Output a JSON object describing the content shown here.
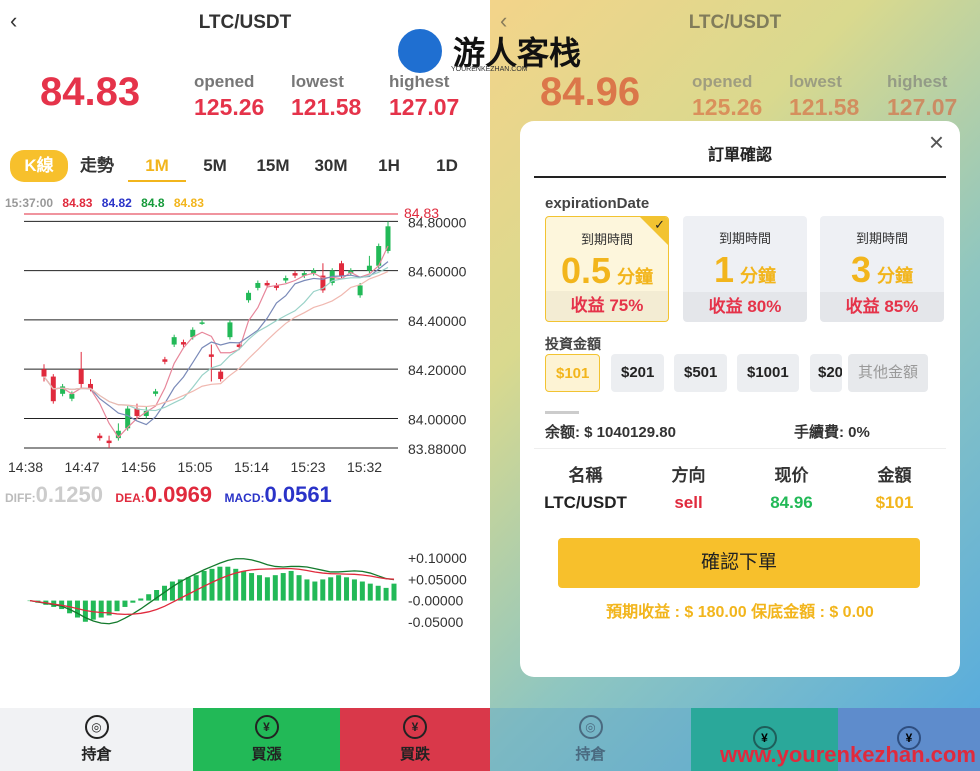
{
  "left": {
    "pair": "LTC/USDT",
    "price": "84.83",
    "stats": [
      {
        "label": "opened",
        "value": "125.26"
      },
      {
        "label": "lowest",
        "value": "121.58"
      },
      {
        "label": "highest",
        "value": "127.07"
      }
    ],
    "tabs": [
      "K線",
      "走勢",
      "1M",
      "5M",
      "15M",
      "30M",
      "1H",
      "1D"
    ],
    "legend": [
      "15:37:00",
      "84.83",
      "84.82",
      "84.8",
      "84.83"
    ],
    "macd": {
      "diff_label": "DIFF:",
      "diff": "0.1250",
      "dea_label": "DEA:",
      "dea": "0.0969",
      "macd_label": "MACD:",
      "macd": "0.0561"
    },
    "bottom": [
      "持倉",
      "買漲",
      "買跌"
    ]
  },
  "right": {
    "pair": "LTC/USDT",
    "price": "84.96",
    "stats": [
      {
        "label": "opened",
        "value": "125.26"
      },
      {
        "label": "lowest",
        "value": "121.58"
      },
      {
        "label": "highest",
        "value": "127.07"
      }
    ],
    "bottom": [
      "持倉"
    ]
  },
  "modal": {
    "title": "訂單確認",
    "close": "×",
    "expiration_label": "expirationDate",
    "options": [
      {
        "title": "到期時間",
        "num": "0.5",
        "unit": "分鐘",
        "profit": "收益 75%"
      },
      {
        "title": "到期時間",
        "num": "1",
        "unit": "分鐘",
        "profit": "收益 80%"
      },
      {
        "title": "到期時間",
        "num": "3",
        "unit": "分鐘",
        "profit": "收益 85%"
      }
    ],
    "amount_label": "投資金額",
    "amounts": [
      "$101",
      "$201",
      "$501",
      "$1001",
      "$20"
    ],
    "other_amount": "其他金額",
    "balance": "余额: $ 1040129.80",
    "fee": "手續費:  0%",
    "table_headers": [
      "名稱",
      "方向",
      "现价",
      "金額"
    ],
    "table_values": [
      "LTC/USDT",
      "sell",
      "84.96",
      "$101"
    ],
    "confirm": "確認下單",
    "footer": "預期收益 : $ 180.00    保底金額 : $ 0.00"
  },
  "watermark": {
    "text": "游人客栈",
    "sub": "YOURENKEZHAN.COM",
    "url": "www.yourenkezhan.com"
  },
  "chart_data": [
    {
      "type": "candlestick",
      "x_ticks": [
        "14:38",
        "14:47",
        "14:56",
        "15:05",
        "15:14",
        "15:23",
        "15:32"
      ],
      "y_ticks": [
        "84.80000",
        "84.60000",
        "84.40000",
        "84.20000",
        "84.00000",
        "83.88000"
      ],
      "last_price_label": "84.83",
      "ylim": [
        83.88,
        84.83
      ],
      "candles": [
        {
          "o": 84.2,
          "c": 84.17,
          "h": 84.22,
          "l": 84.15
        },
        {
          "o": 84.17,
          "c": 84.07,
          "h": 84.18,
          "l": 84.06
        },
        {
          "o": 84.1,
          "c": 84.13,
          "h": 84.14,
          "l": 84.09
        },
        {
          "o": 84.08,
          "c": 84.1,
          "h": 84.11,
          "l": 84.07
        },
        {
          "o": 84.2,
          "c": 84.14,
          "h": 84.27,
          "l": 84.12
        },
        {
          "o": 84.14,
          "c": 84.12,
          "h": 84.16,
          "l": 84.11
        },
        {
          "o": 83.93,
          "c": 83.92,
          "h": 83.94,
          "l": 83.91
        },
        {
          "o": 83.91,
          "c": 83.9,
          "h": 83.93,
          "l": 83.88
        },
        {
          "o": 83.92,
          "c": 83.95,
          "h": 83.98,
          "l": 83.91
        },
        {
          "o": 83.96,
          "c": 84.04,
          "h": 84.05,
          "l": 83.95
        },
        {
          "o": 84.04,
          "c": 84.01,
          "h": 84.06,
          "l": 84.0
        },
        {
          "o": 84.01,
          "c": 84.03,
          "h": 84.05,
          "l": 84.0
        },
        {
          "o": 84.1,
          "c": 84.11,
          "h": 84.12,
          "l": 84.09
        },
        {
          "o": 84.24,
          "c": 84.23,
          "h": 84.25,
          "l": 84.22
        },
        {
          "o": 84.3,
          "c": 84.33,
          "h": 84.34,
          "l": 84.29
        },
        {
          "o": 84.31,
          "c": 84.3,
          "h": 84.32,
          "l": 84.29
        },
        {
          "o": 84.33,
          "c": 84.36,
          "h": 84.37,
          "l": 84.32
        },
        {
          "o": 84.39,
          "c": 84.39,
          "h": 84.4,
          "l": 84.38
        },
        {
          "o": 84.26,
          "c": 84.25,
          "h": 84.3,
          "l": 84.15
        },
        {
          "o": 84.19,
          "c": 84.16,
          "h": 84.2,
          "l": 84.15
        },
        {
          "o": 84.33,
          "c": 84.39,
          "h": 84.4,
          "l": 84.32
        },
        {
          "o": 84.3,
          "c": 84.29,
          "h": 84.31,
          "l": 84.28
        },
        {
          "o": 84.48,
          "c": 84.51,
          "h": 84.52,
          "l": 84.47
        },
        {
          "o": 84.53,
          "c": 84.55,
          "h": 84.56,
          "l": 84.52
        },
        {
          "o": 84.55,
          "c": 84.54,
          "h": 84.56,
          "l": 84.53
        },
        {
          "o": 84.54,
          "c": 84.53,
          "h": 84.55,
          "l": 84.52
        },
        {
          "o": 84.56,
          "c": 84.57,
          "h": 84.58,
          "l": 84.55
        },
        {
          "o": 84.59,
          "c": 84.58,
          "h": 84.6,
          "l": 84.57
        },
        {
          "o": 84.58,
          "c": 84.59,
          "h": 84.6,
          "l": 84.57
        },
        {
          "o": 84.59,
          "c": 84.6,
          "h": 84.61,
          "l": 84.58
        },
        {
          "o": 84.58,
          "c": 84.52,
          "h": 84.63,
          "l": 84.51
        },
        {
          "o": 84.55,
          "c": 84.6,
          "h": 84.61,
          "l": 84.54
        },
        {
          "o": 84.63,
          "c": 84.58,
          "h": 84.64,
          "l": 84.57
        },
        {
          "o": 84.59,
          "c": 84.6,
          "h": 84.61,
          "l": 84.58
        },
        {
          "o": 84.5,
          "c": 84.54,
          "h": 84.55,
          "l": 84.49
        },
        {
          "o": 84.6,
          "c": 84.62,
          "h": 84.66,
          "l": 84.59
        },
        {
          "o": 84.62,
          "c": 84.7,
          "h": 84.71,
          "l": 84.61
        },
        {
          "o": 84.68,
          "c": 84.78,
          "h": 84.8,
          "l": 84.67
        }
      ]
    },
    {
      "type": "bar",
      "y_ticks": [
        "+0.10000",
        "+0.05000",
        "-0.00000",
        "-0.05000"
      ],
      "ylim": [
        -0.06,
        0.11
      ],
      "values": [
        0,
        -0.005,
        -0.01,
        -0.015,
        -0.02,
        -0.03,
        -0.04,
        -0.05,
        -0.045,
        -0.04,
        -0.035,
        -0.025,
        -0.015,
        -0.005,
        0.005,
        0.015,
        0.025,
        0.035,
        0.045,
        0.05,
        0.055,
        0.06,
        0.07,
        0.075,
        0.08,
        0.08,
        0.075,
        0.07,
        0.065,
        0.06,
        0.055,
        0.06,
        0.065,
        0.07,
        0.06,
        0.05,
        0.045,
        0.05,
        0.055,
        0.06,
        0.055,
        0.05,
        0.045,
        0.04,
        0.035,
        0.03,
        0.04
      ]
    }
  ]
}
